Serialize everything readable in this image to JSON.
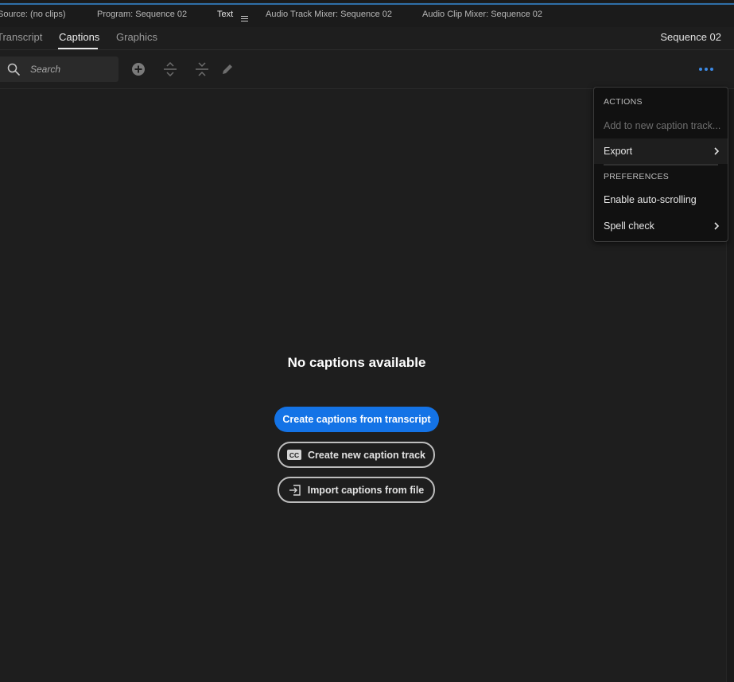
{
  "panel_tabs": [
    {
      "label": "Source: (no clips)"
    },
    {
      "label": "Program: Sequence 02"
    },
    {
      "label": "Text"
    },
    {
      "label": "Audio Track Mixer: Sequence 02"
    },
    {
      "label": "Audio Clip Mixer: Sequence 02"
    }
  ],
  "sub_tabs": [
    {
      "label": "Transcript"
    },
    {
      "label": "Captions"
    },
    {
      "label": "Graphics"
    }
  ],
  "sequence_name": "Sequence 02",
  "search": {
    "placeholder": "Search"
  },
  "toolbar_icons": [
    "add-caption-icon",
    "split-caption-icon",
    "merge-caption-icon",
    "edit-pencil-icon",
    "more-options-icon"
  ],
  "empty_state": {
    "title": "No captions available",
    "primary_button": "Create captions from transcript",
    "new_track_button": "Create new caption track",
    "import_button": "Import captions from file"
  },
  "menu": {
    "actions_header": "ACTIONS",
    "add_to_track": "Add to new caption track...",
    "export": "Export",
    "preferences_header": "PREFERENCES",
    "auto_scroll": "Enable auto-scrolling",
    "spell_check": "Spell check"
  },
  "colors": {
    "accent": "#1473e6",
    "background": "#1e1e1e",
    "menu_background": "#111111"
  }
}
